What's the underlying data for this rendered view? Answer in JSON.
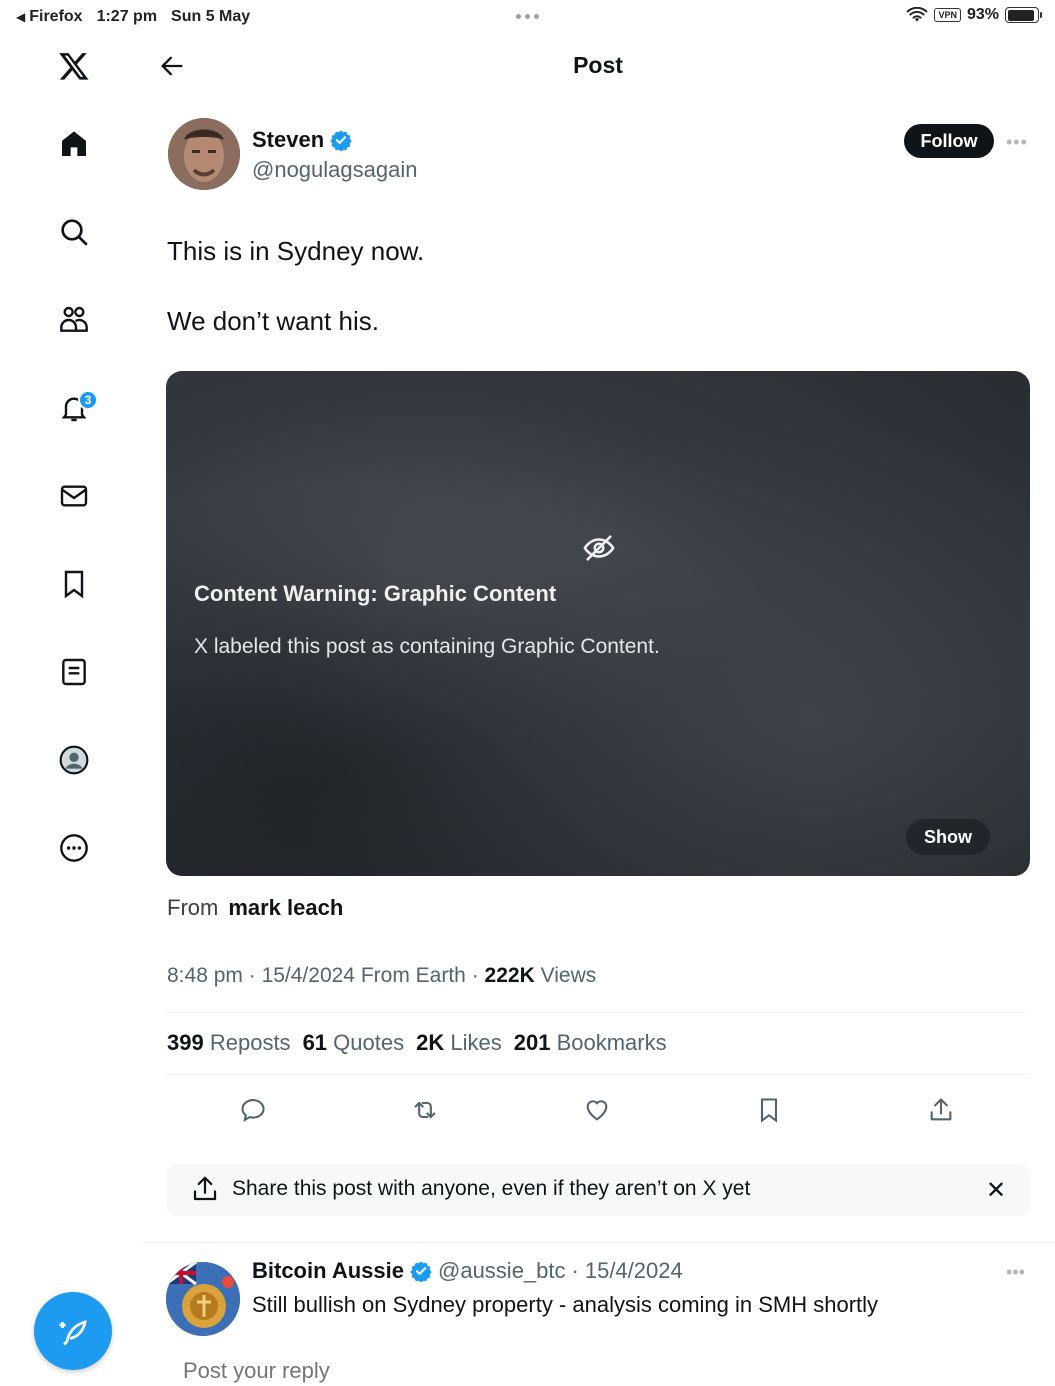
{
  "status_bar": {
    "app": "Firefox",
    "time": "1:27 pm",
    "date": "Sun 5 May",
    "vpn": "VPN",
    "battery": "93%"
  },
  "header": {
    "title": "Post"
  },
  "author": {
    "name": "Steven",
    "handle": "@nogulagsagain",
    "follow_label": "Follow"
  },
  "post": {
    "line1": "This is in Sydney now.",
    "line2": "We don’t want his."
  },
  "media": {
    "warning_title": "Content Warning: Graphic Content",
    "warning_desc": "X labeled this post as containing Graphic Content.",
    "show_label": "Show"
  },
  "source": {
    "label": "From",
    "name": "mark leach"
  },
  "meta": {
    "time": "8:48 pm",
    "date": "15/4/2024",
    "location": "From Earth",
    "views_count": "222K",
    "views_label": "Views"
  },
  "stats": [
    {
      "count": "399",
      "label": "Reposts"
    },
    {
      "count": "61",
      "label": "Quotes"
    },
    {
      "count": "2K",
      "label": "Likes"
    },
    {
      "count": "201",
      "label": "Bookmarks"
    }
  ],
  "notifications_badge": "3",
  "share_banner": {
    "text": "Share this post with anyone, even if they aren’t on X yet",
    "close": "✕"
  },
  "reply": {
    "name": "Bitcoin Aussie",
    "handle": "@aussie_btc",
    "date": "15/4/2024",
    "text": "Still bullish on Sydney property - analysis coming in SMH shortly"
  },
  "reply_input": {
    "placeholder": "Post your reply"
  },
  "colors": {
    "accent": "#1d9bf0",
    "text": "#0f1419",
    "muted": "#536471"
  }
}
